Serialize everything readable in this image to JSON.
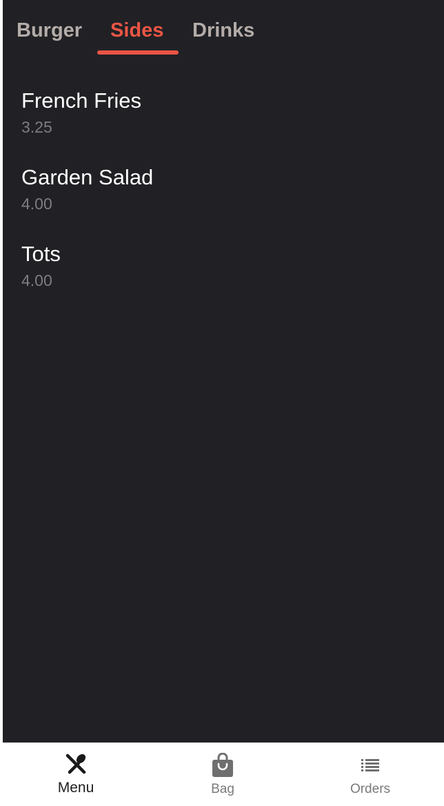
{
  "tabs": [
    {
      "label": "Burger",
      "active": false
    },
    {
      "label": "Sides",
      "active": true
    },
    {
      "label": "Drinks",
      "active": false
    }
  ],
  "items": [
    {
      "name": "French Fries",
      "price": "3.25"
    },
    {
      "name": "Garden Salad",
      "price": "4.00"
    },
    {
      "name": "Tots",
      "price": "4.00"
    }
  ],
  "bottom_nav": {
    "menu": {
      "label": "Menu",
      "icon": "utensils-icon"
    },
    "bag": {
      "label": "Bag",
      "icon": "shopping-bag-icon"
    },
    "orders": {
      "label": "Orders",
      "icon": "list-icon"
    }
  },
  "colors": {
    "background": "#212125",
    "accent": "#ea5544",
    "inactive_tab": "#b4aca9",
    "item_name": "#ffffff",
    "item_price": "#7e7e82"
  }
}
